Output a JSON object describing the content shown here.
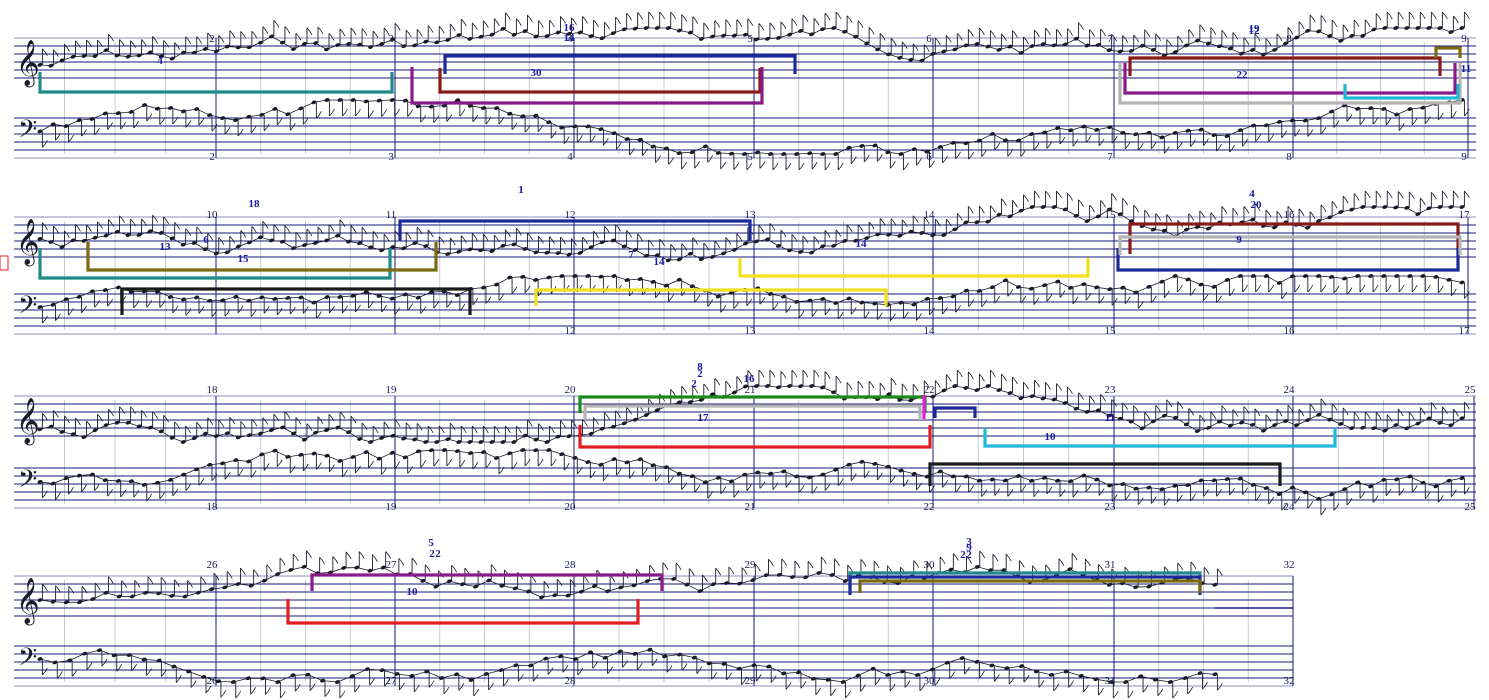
{
  "colors": {
    "staff": "#1a1a7a",
    "note": "#1a1a2a",
    "label": "#1a1aa0",
    "teal": "#1e8a8a",
    "navy": "#1a2a9a",
    "maroon": "#8a1a1a",
    "purple": "#8a1a8a",
    "olive": "#7a6a10",
    "gray": "#b4b4b4",
    "cyan": "#20b8d8",
    "yellow": "#f0e020",
    "green": "#1a8a1a",
    "red": "#e02020",
    "black": "#1a1a1a",
    "magenta": "#e020e0"
  },
  "clefs": {
    "treble": "𝄞",
    "bass": "𝄢"
  },
  "systems": [
    {
      "top_numbers": [
        "2",
        "3",
        "4",
        "5",
        "6",
        "7",
        "8",
        "9"
      ],
      "bottom_numbers": [
        "2",
        "3",
        "4",
        "5",
        "6",
        "7",
        "8",
        "9"
      ],
      "labels": [
        "4",
        "16",
        "14",
        "30",
        "19",
        "12",
        "22",
        "11"
      ]
    },
    {
      "top_numbers": [
        "10",
        "11",
        "12",
        "13",
        "14",
        "15",
        "16",
        "17"
      ],
      "bottom_numbers": [
        "12",
        "13",
        "14",
        "15",
        "16",
        "17"
      ],
      "labels": [
        "18",
        "1",
        "15",
        "6",
        "13",
        "7",
        "14",
        "14",
        "4",
        "20",
        "9"
      ]
    },
    {
      "top_numbers": [
        "18",
        "19",
        "20",
        "21",
        "22",
        "23",
        "24",
        "25"
      ],
      "bottom_numbers": [
        "18",
        "19",
        "20",
        "21",
        "22",
        "23",
        "24",
        "25"
      ],
      "labels": [
        "8",
        "2",
        "2",
        "16",
        "17",
        "11",
        "10"
      ]
    },
    {
      "top_numbers": [
        "26",
        "27",
        "28",
        "29",
        "30",
        "31",
        "32"
      ],
      "bottom_numbers": [
        "26",
        "27",
        "28",
        "29",
        "30",
        "31",
        "32"
      ],
      "labels": [
        "5",
        "2",
        "2",
        "10",
        "3",
        "9",
        "2",
        "2"
      ]
    }
  ]
}
